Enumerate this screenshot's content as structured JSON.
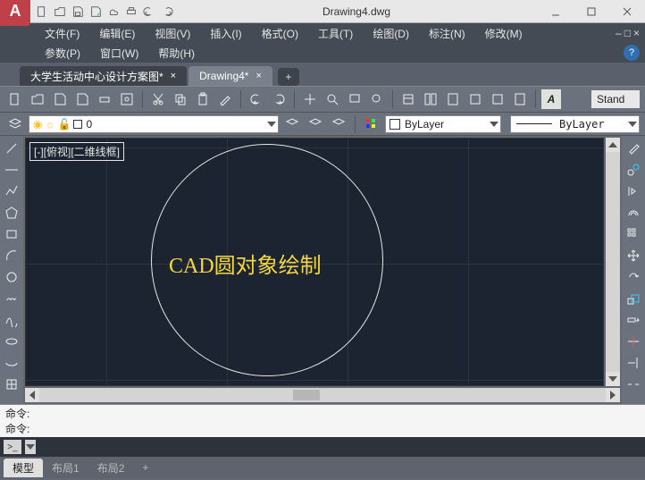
{
  "title": "Drawing4.dwg",
  "menus1": [
    "文件(F)",
    "编辑(E)",
    "视图(V)",
    "插入(I)",
    "格式(O)",
    "工具(T)",
    "绘图(D)",
    "标注(N)",
    "修改(M)"
  ],
  "menus2": [
    "参数(P)",
    "窗口(W)",
    "帮助(H)"
  ],
  "tabs": {
    "inactive": "大学生活动中心设计方案图*",
    "active": "Drawing4*"
  },
  "layer": {
    "name": "0",
    "color_label": "ByLayer",
    "linetype": "ByLayer"
  },
  "style_label": "Stand",
  "view_label": "[-][俯视][二维线框]",
  "annotation": "CAD圆对象绘制",
  "cmd_prompt": "命令:",
  "status": {
    "model": "模型",
    "layout1": "布局1",
    "layout2": "布局2"
  }
}
